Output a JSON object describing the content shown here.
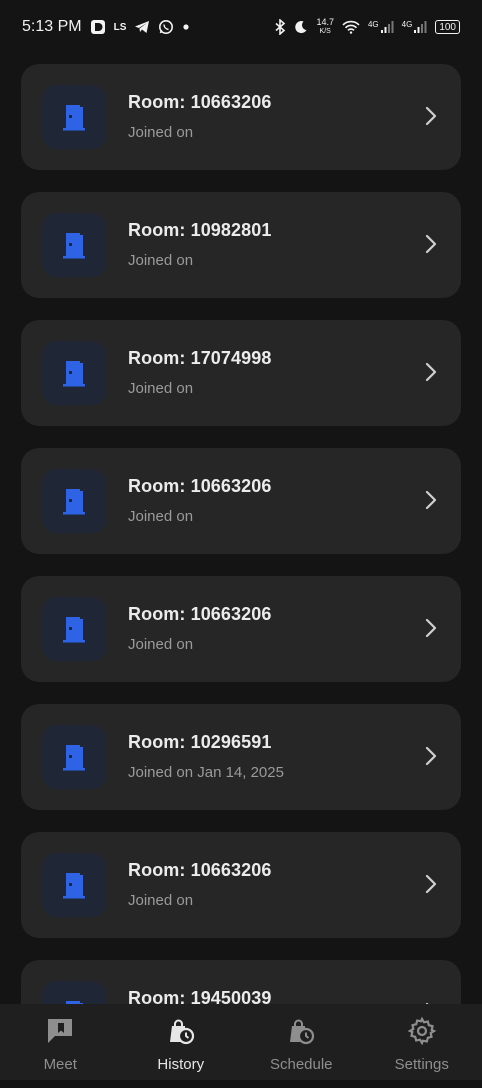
{
  "status_bar": {
    "time": "5:13 PM",
    "speed": "14.7",
    "speed_unit": "K/S",
    "network1": "4G",
    "network2": "4G",
    "battery": "100"
  },
  "rooms": [
    {
      "title": "Room: 10663206",
      "subtitle": "Joined on"
    },
    {
      "title": "Room: 10982801",
      "subtitle": "Joined on"
    },
    {
      "title": "Room: 17074998",
      "subtitle": "Joined on"
    },
    {
      "title": "Room: 10663206",
      "subtitle": "Joined on"
    },
    {
      "title": "Room: 10663206",
      "subtitle": "Joined on"
    },
    {
      "title": "Room: 10296591",
      "subtitle": "Joined on Jan 14, 2025"
    },
    {
      "title": "Room: 10663206",
      "subtitle": "Joined on"
    },
    {
      "title": "Room: 19450039",
      "subtitle": ""
    }
  ],
  "nav": {
    "meet": "Meet",
    "history": "History",
    "schedule": "Schedule",
    "settings": "Settings"
  },
  "colors": {
    "accent": "#2f63e6",
    "background": "#141414",
    "card": "#262626",
    "icon_bg": "#1f2636"
  },
  "icons": {
    "room": "door-icon",
    "chevron": "chevron-right-icon",
    "meet": "chat-icon",
    "history": "bag-clock-icon",
    "schedule": "bag-clock-icon",
    "settings": "gear-icon"
  }
}
